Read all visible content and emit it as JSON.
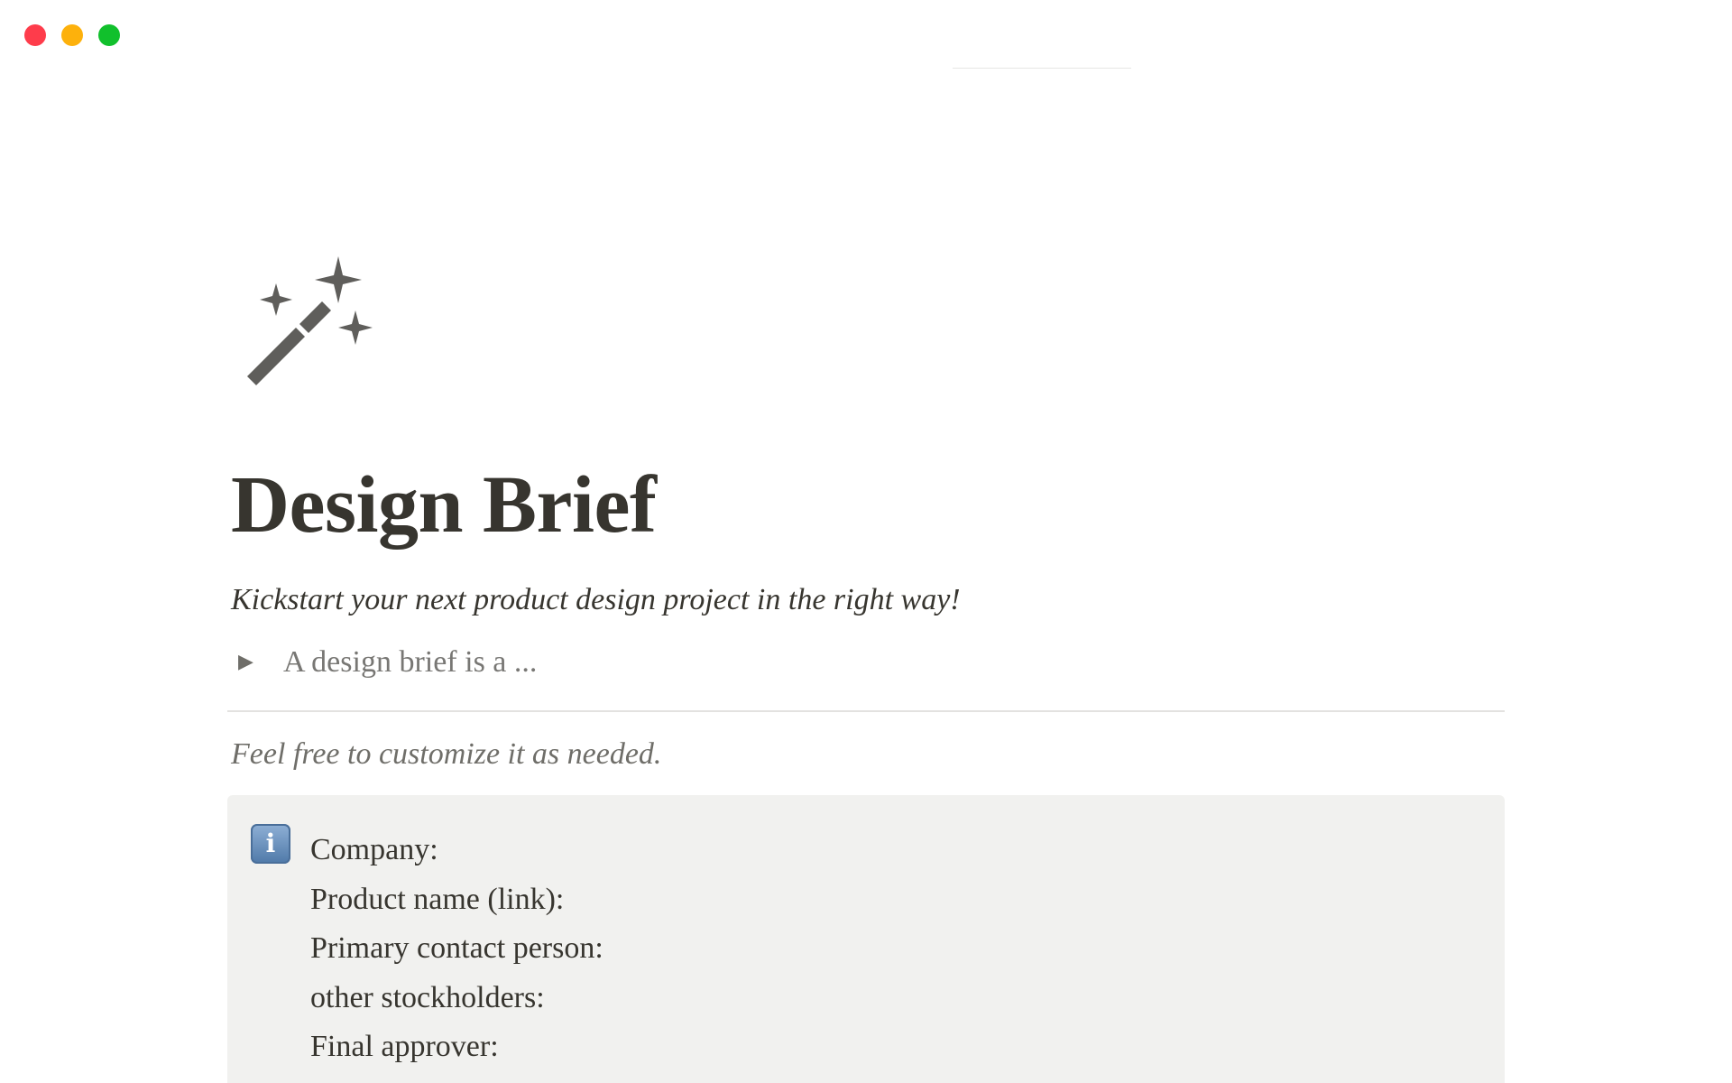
{
  "window": {
    "controls": [
      "close",
      "minimize",
      "maximize"
    ],
    "colors": {
      "close": "#fe3c4b",
      "minimize": "#fdb10c",
      "maximize": "#11c02c"
    }
  },
  "page": {
    "icon": "magic-wand-sparkles-icon",
    "title": "Design Brief",
    "subtitle": "Kickstart your next product design project in the right way!",
    "toggle": {
      "icon": "triangle-right-icon",
      "label": "A design brief is a ..."
    },
    "note": "Feel free to customize it as needed.",
    "callout": {
      "icon": "information-icon",
      "icon_glyph": "i",
      "lines": [
        "Company:",
        "Product name (link):",
        "Primary contact person:",
        "other stockholders:",
        "Final approver:"
      ]
    }
  },
  "colors": {
    "text": "#37352f",
    "muted": "#787774",
    "callout_bg": "#f1f1ef",
    "icon_fill": "#5f5e5b"
  }
}
